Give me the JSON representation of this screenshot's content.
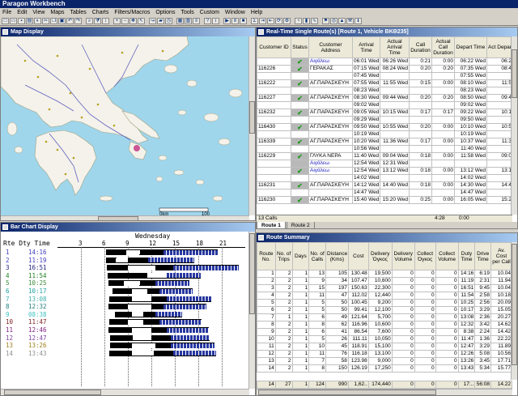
{
  "app": {
    "title": "Paragon Workbench"
  },
  "menu": [
    "File",
    "Edit",
    "View",
    "Maps",
    "Tables",
    "Charts",
    "Filters/Macros",
    "Options",
    "Tools",
    "Custom",
    "Window",
    "Help"
  ],
  "map": {
    "title": "Map Display",
    "scale": [
      "0km",
      "100"
    ]
  },
  "rt": {
    "title": "Real-Time Single Route(s) [Route 1, Vehicle ΒΚΘ235]",
    "headers": [
      "Customer ID",
      "Status",
      "Customer Address",
      "Arrival Time",
      "Actual Arrival Time",
      "Call Duration",
      "Actual Call Duration",
      "Depart Time",
      "Act Depar"
    ],
    "rows": [
      [
        "",
        "✔",
        "Αιγάλεω",
        "06:01 Wed",
        "06:26 Wed",
        "0:21",
        "0:00",
        "06:22 Wed",
        "06:2"
      ],
      [
        "116226",
        "✔",
        "ΓΕΡΑΚΑΣ",
        "07:15 Wed",
        "08:24 Wed",
        "0:20",
        "0:20",
        "07:35 Wed",
        "08:4"
      ],
      [
        "",
        "",
        "",
        "07:45 Wed",
        "",
        "",
        "",
        "07:55 Wed",
        ""
      ],
      [
        "116222",
        "✔",
        "ΑΓ.ΠΑΡΑΣΚΕΥΗ",
        "07:55 Wed",
        "11:55 Wed",
        "0:15",
        "0:00",
        "08:10 Wed",
        "11:5"
      ],
      [
        "",
        "",
        "",
        "08:23 Wed",
        "",
        "",
        "",
        "08:23 Wed",
        ""
      ],
      [
        "116227",
        "✔",
        "ΑΓ.ΠΑΡΑΣΚΕΥΗ",
        "08:30 Wed",
        "09:44 Wed",
        "0:20",
        "0:20",
        "08:50 Wed",
        "09:4"
      ],
      [
        "",
        "",
        "",
        "09:02 Wed",
        "",
        "",
        "",
        "09:02 Wed",
        ""
      ],
      [
        "116232",
        "✔",
        "ΑΓ.ΠΑΡΑΣΚΕΥΗ",
        "09:05 Wed",
        "10:15 Wed",
        "0:17",
        "0:17",
        "09:22 Wed",
        "10:1"
      ],
      [
        "",
        "",
        "",
        "09:29 Wed",
        "",
        "",
        "",
        "09:50 Wed",
        ""
      ],
      [
        "116430",
        "✔",
        "ΑΓ.ΠΑΡΑΣΚΕΥΗ",
        "09:50 Wed",
        "10:55 Wed",
        "0:20",
        "0:00",
        "10:10 Wed",
        "10:5"
      ],
      [
        "",
        "",
        "",
        "10:19 Wed",
        "",
        "",
        "",
        "10:19 Wed",
        ""
      ],
      [
        "116339",
        "✔",
        "ΑΓ.ΠΑΡΑΣΚΕΥΗ",
        "10:20 Wed",
        "11:36 Wed",
        "0:17",
        "0:00",
        "10:37 Wed",
        "11:3"
      ],
      [
        "",
        "",
        "",
        "10:56 Wed",
        "",
        "",
        "",
        "11:40 Wed",
        ""
      ],
      [
        "116229",
        "✔",
        "ΓΛΥΚΑ ΝΕΡΑ",
        "11:40 Wed",
        "09:04 Wed",
        "0:18",
        "0:00",
        "11:58 Wed",
        "09:0"
      ],
      [
        "",
        "",
        "Αιγάλεω",
        "12:54 Wed",
        "12:31 Wed",
        "",
        "",
        "",
        ""
      ],
      [
        "",
        "✔",
        "Αιγάλεω",
        "12:54 Wed",
        "13:12 Wed",
        "0:18",
        "0:00",
        "13:12 Wed",
        "13:1"
      ],
      [
        "",
        "",
        "",
        "14:02 Wed",
        "",
        "",
        "",
        "14:02 Wed",
        ""
      ],
      [
        "116231",
        "✔",
        "ΑΓ.ΠΑΡΑΣΚΕΥΗ",
        "14:12 Wed",
        "14:40 Wed",
        "0:18",
        "0:00",
        "14:30 Wed",
        "14:4"
      ],
      [
        "",
        "",
        "",
        "14:47 Wed",
        "",
        "",
        "",
        "14:47 Wed",
        ""
      ],
      [
        "116230",
        "✔",
        "ΑΓ.ΠΑΡΑΣΚΕΥΗ",
        "15:40 Wed",
        "15:20 Wed",
        "0:25",
        "0:00",
        "16:05 Wed",
        "15:2"
      ]
    ],
    "footer": {
      "calls": "13 Calls",
      "total": "4:28",
      "total2": "0:00"
    },
    "tabs": [
      "Route 1",
      "Route 2"
    ]
  },
  "bc": {
    "title": "Bar Chart Display",
    "header": "Rte Dty Time",
    "day": "Wednesday",
    "hours": [
      "3",
      "6",
      "9",
      "12",
      "15",
      "18",
      "21"
    ],
    "rows": [
      {
        "rte": "1",
        "dty": "14:16",
        "color": "#4040c0"
      },
      {
        "rte": "2",
        "dty": "11:19",
        "color": "#4040c0"
      },
      {
        "rte": "3",
        "dty": "16:51",
        "color": "#202080"
      },
      {
        "rte": "4",
        "dty": "11:54",
        "color": "#208020"
      },
      {
        "rte": "5",
        "dty": "10:25",
        "color": "#3c8c3c"
      },
      {
        "rte": "6",
        "dty": "10:17",
        "color": "#20a0a0"
      },
      {
        "rte": "7",
        "dty": "13:08",
        "color": "#40b0b0"
      },
      {
        "rte": "8",
        "dty": "12:32",
        "color": "#208080"
      },
      {
        "rte": "9",
        "dty": "08:38",
        "color": "#40c0c0"
      },
      {
        "rte": "10",
        "dty": "11:47",
        "color": "#802020"
      },
      {
        "rte": "11",
        "dty": "12:46",
        "color": "#802080"
      },
      {
        "rte": "12",
        "dty": "12:47",
        "color": "#8040a0"
      },
      {
        "rte": "13",
        "dty": "13:26",
        "color": "#a08020"
      },
      {
        "rte": "14",
        "dty": "13:43",
        "color": "#909090"
      }
    ]
  },
  "rs": {
    "title": "Route Summary",
    "headers": [
      "Route No.",
      "No. of Trips",
      "Days",
      "No. of Calls",
      "Distance (Kms)",
      "Cost",
      "Delivery Όγκος",
      "Delivery Volume",
      "Collect Όγκος",
      "Collect Volume",
      "Duty Time",
      "Drive Time",
      "Av. Cost per Call"
    ],
    "rows": [
      [
        "1",
        "2",
        "1",
        "13",
        "105",
        "130.48",
        "19,500",
        "0",
        "0",
        "0",
        "14:16",
        "6:19",
        "10.04"
      ],
      [
        "2",
        "2",
        "1",
        "9",
        "34",
        "107.47",
        "10,600",
        "0",
        "0",
        "0",
        "11:19",
        "2:31",
        "11.94"
      ],
      [
        "3",
        "2",
        "1",
        "15",
        "197",
        "150.63",
        "22,300",
        "0",
        "0",
        "0",
        "16:51",
        "9:45",
        "10.04"
      ],
      [
        "4",
        "2",
        "1",
        "11",
        "47",
        "112.02",
        "12,440",
        "0",
        "0",
        "0",
        "11:54",
        "2:58",
        "10.18"
      ],
      [
        "5",
        "2",
        "1",
        "5",
        "50",
        "100.45",
        "9,200",
        "0",
        "0",
        "0",
        "10:25",
        "2:56",
        "20.09"
      ],
      [
        "6",
        "2",
        "1",
        "5",
        "50",
        "99.41",
        "12,100",
        "0",
        "0",
        "0",
        "10:17",
        "3:29",
        "15.05"
      ],
      [
        "7",
        "1",
        "1",
        "6",
        "49",
        "121.64",
        "5,700",
        "0",
        "0",
        "0",
        "13:08",
        "2:36",
        "20.27"
      ],
      [
        "8",
        "2",
        "1",
        "8",
        "62",
        "116.96",
        "10,600",
        "0",
        "0",
        "0",
        "12:32",
        "3:42",
        "14.62"
      ],
      [
        "9",
        "2",
        "1",
        "6",
        "41",
        "86.54",
        "7,600",
        "0",
        "0",
        "0",
        "8:38",
        "2:24",
        "14.42"
      ],
      [
        "10",
        "2",
        "1",
        "5",
        "26",
        "111.11",
        "10,050",
        "0",
        "0",
        "0",
        "11:47",
        "1:36",
        "22.22"
      ],
      [
        "11",
        "2",
        "1",
        "10",
        "45",
        "118.91",
        "15,100",
        "0",
        "0",
        "0",
        "12:47",
        "3:29",
        "11.89"
      ],
      [
        "12",
        "2",
        "1",
        "11",
        "76",
        "116.18",
        "13,100",
        "0",
        "0",
        "0",
        "12:26",
        "5:08",
        "10.56"
      ],
      [
        "13",
        "2",
        "1",
        "7",
        "58",
        "123.98",
        "9,000",
        "0",
        "0",
        "0",
        "13:26",
        "3:45",
        "17.71"
      ],
      [
        "14",
        "2",
        "1",
        "8",
        "150",
        "126.19",
        "17,250",
        "0",
        "0",
        "0",
        "13:43",
        "5:34",
        "15.77"
      ]
    ],
    "total": [
      "14",
      "27",
      "1",
      "124",
      "990",
      "1,62..",
      "174,440",
      "0",
      "0",
      "0",
      "17:..",
      "56:08",
      "14.22"
    ]
  },
  "colors": {
    "titlebar": "#0a246a",
    "accent": "#4040c0"
  }
}
